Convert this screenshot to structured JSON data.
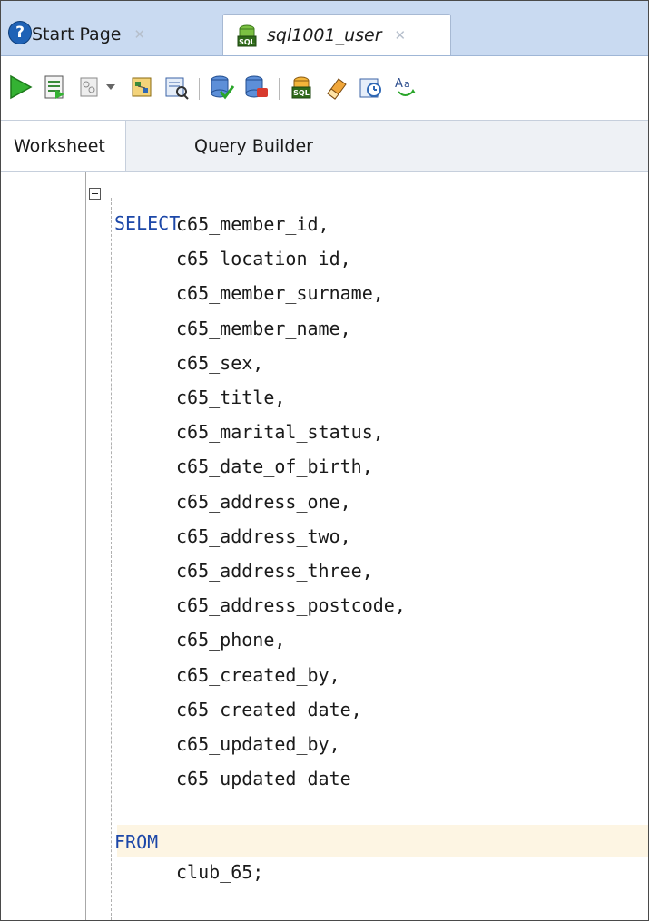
{
  "tabs": [
    {
      "label": "Start Page",
      "icon": "help-icon",
      "closable": true
    },
    {
      "label": "sql1001_user",
      "icon": "sql-connection-icon",
      "closable": true,
      "active": true
    }
  ],
  "toolbar": {
    "buttons": [
      "run-statement-icon",
      "run-script-icon",
      "autotrace-icon",
      "dropdown-arrow-icon",
      "explain-plan-icon",
      "sql-tuning-icon",
      "commit-icon",
      "rollback-icon",
      "unshared-sql-worksheet-icon",
      "clear-icon",
      "sql-history-icon",
      "to-upper-lower-icon"
    ]
  },
  "subtabs": {
    "worksheet": "Worksheet",
    "query_builder": "Query Builder"
  },
  "editor": {
    "select_kw": "SELECT",
    "columns": [
      "c65_member_id,",
      "c65_location_id,",
      "c65_member_surname,",
      "c65_member_name,",
      "c65_sex,",
      "c65_title,",
      "c65_marital_status,",
      "c65_date_of_birth,",
      "c65_address_one,",
      "c65_address_two,",
      "c65_address_three,",
      "c65_address_postcode,",
      "c65_phone,",
      "c65_created_by,",
      "c65_created_date,",
      "c65_updated_by,",
      "c65_updated_date"
    ],
    "from_kw": "FROM",
    "table": "club_65;"
  },
  "colors": {
    "tabstrip_bg": "#c9daf1",
    "keyword": "#1c47a8",
    "current_line": "#fdf5e3"
  }
}
